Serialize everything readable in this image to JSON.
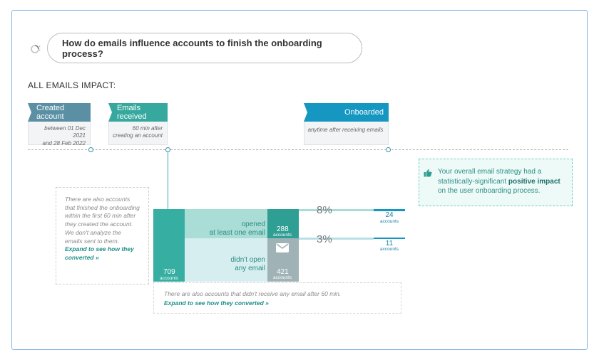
{
  "question": "How do emails influence accounts to finish the onboarding process?",
  "question_icon": "loading-spinner-icon",
  "question_colon": ":",
  "section_title": "ALL EMAILS IMPACT:",
  "milestones": [
    {
      "label": "Created account",
      "detail_line1": "between 01 Dec 2021",
      "detail_line2": "and 28 Feb 2022",
      "color": "#5b8fa4"
    },
    {
      "label": "Emails received",
      "detail_line1": "60 min after",
      "detail_line2": "creating an account",
      "color": "#36a89d"
    },
    {
      "label": "Onboarded",
      "detail_line1": "anytime after receiving emails",
      "detail_line2": "",
      "color": "#1697c1"
    }
  ],
  "insight": {
    "icon": "thumbs-up-icon",
    "text_before": "Your overall email strategy had a statistically-significant ",
    "highlight": "positive impact",
    "text_after": " on the user onboarding process."
  },
  "note_left": {
    "text": "There are also accounts that finished the onboarding within the first 60 min after they created the account. We don't analyze the emails sent to them.",
    "link": "Expand to see how they converted »"
  },
  "funnel": {
    "total": {
      "value": "709",
      "unit": "accounts"
    },
    "opened": {
      "label_line1": "opened",
      "label_line2": "at least one email",
      "value": "288",
      "unit": "accounts",
      "conversion": "8%",
      "onboarded": "24",
      "onboarded_unit": "accounts"
    },
    "didnt_open": {
      "label_line1": "didn't open",
      "label_line2": "any email",
      "icon": "envelope-icon",
      "value": "421",
      "unit": "accounts",
      "conversion": "3%",
      "onboarded": "11",
      "onboarded_unit": "accounts"
    }
  },
  "note_bottom": {
    "text": "There are also accounts that didn't receive any email after 60 min.",
    "link": "Expand to see how they converted »"
  }
}
